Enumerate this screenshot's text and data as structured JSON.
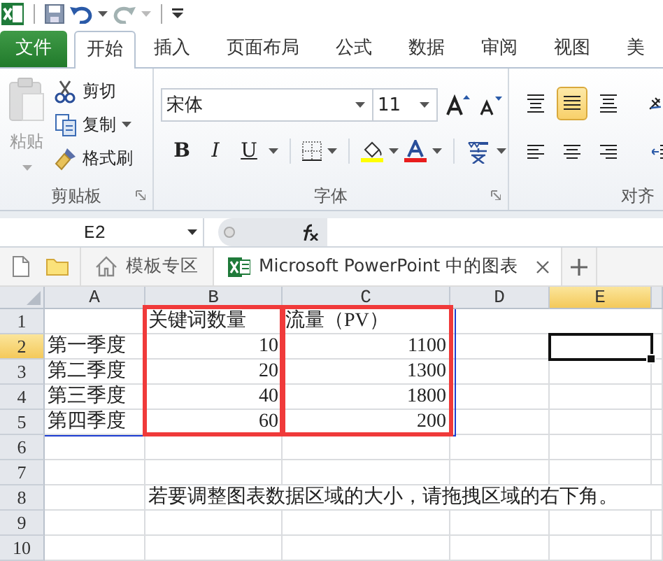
{
  "quick_access": [
    {
      "kind": "logo",
      "disabled": false
    },
    {
      "kind": "save",
      "disabled": false
    },
    {
      "kind": "undo",
      "disabled": false
    },
    {
      "kind": "redo",
      "disabled": true
    },
    {
      "kind": "customize",
      "disabled": false
    }
  ],
  "ribbon_tabs": [
    {
      "label": "文件",
      "kind": "file",
      "selected": false
    },
    {
      "label": "开始",
      "kind": "tab",
      "selected": true
    },
    {
      "label": "插入",
      "kind": "tab",
      "selected": false
    },
    {
      "label": "页面布局",
      "kind": "tab",
      "selected": false
    },
    {
      "label": "公式",
      "kind": "tab",
      "selected": false
    },
    {
      "label": "数据",
      "kind": "tab",
      "selected": false
    },
    {
      "label": "审阅",
      "kind": "tab",
      "selected": false
    },
    {
      "label": "视图",
      "kind": "tab",
      "selected": false
    },
    {
      "label": "美",
      "kind": "tab",
      "selected": false
    }
  ],
  "clipboard": {
    "paste": {
      "label": "粘贴",
      "disabled": true
    },
    "commands": [
      {
        "label": "剪切",
        "kind": "cut"
      },
      {
        "label": "复制",
        "kind": "copy"
      },
      {
        "label": "格式刷",
        "kind": "painter"
      }
    ],
    "group_label": "剪贴板"
  },
  "font": {
    "font_name": "宋体",
    "font_size": "11",
    "style_buttons": [
      {
        "label": "B",
        "kind": "bold"
      },
      {
        "label": "I",
        "kind": "italic"
      },
      {
        "label": "U",
        "kind": "underline"
      }
    ],
    "group_label": "字体"
  },
  "alignment": {
    "buttons": [
      {
        "kind": "top",
        "selected": false
      },
      {
        "kind": "middle",
        "selected": true
      },
      {
        "kind": "bottom",
        "selected": false
      },
      {
        "kind": "orientation",
        "selected": false
      },
      {
        "kind": "left",
        "selected": false
      },
      {
        "kind": "center",
        "selected": false
      },
      {
        "kind": "right",
        "selected": false
      },
      {
        "kind": "indent",
        "selected": false
      }
    ],
    "group_label": "对齐"
  },
  "formula_bar": {
    "name_box": "E2"
  },
  "document_tabs": [
    {
      "label": "模板专区",
      "kind": "home",
      "selected": false
    },
    {
      "label": "Microsoft PowerPoint 中的图表",
      "kind": "workbook",
      "selected": true
    }
  ],
  "sheet": {
    "columns": [
      {
        "label": "A",
        "selected": false,
        "chart_range": true,
        "framed": false
      },
      {
        "label": "B",
        "selected": false,
        "chart_range": true,
        "framed": true
      },
      {
        "label": "C",
        "selected": false,
        "chart_range": true,
        "framed": true
      },
      {
        "label": "D",
        "selected": false,
        "chart_range": false,
        "framed": false
      },
      {
        "label": "E",
        "selected": true,
        "chart_range": false,
        "framed": false
      }
    ],
    "rows": [
      {
        "label": "1",
        "selected": false,
        "chart_range": true,
        "cells": {
          "B": {
            "text": "关键词数量",
            "kind": "text",
            "selected": false
          },
          "C": {
            "text": "流量（PV）",
            "kind": "text",
            "selected": false
          }
        }
      },
      {
        "label": "2",
        "selected": true,
        "chart_range": true,
        "cells": {
          "A": {
            "text": "第一季度",
            "kind": "text",
            "selected": false
          },
          "B": {
            "text": "10",
            "kind": "number",
            "selected": false
          },
          "C": {
            "text": "1100",
            "kind": "number",
            "selected": false
          },
          "E": {
            "selected": true
          }
        }
      },
      {
        "label": "3",
        "selected": false,
        "chart_range": true,
        "cells": {
          "A": {
            "text": "第二季度",
            "kind": "text",
            "selected": false
          },
          "B": {
            "text": "20",
            "kind": "number",
            "selected": false
          },
          "C": {
            "text": "1300",
            "kind": "number",
            "selected": false
          }
        }
      },
      {
        "label": "4",
        "selected": false,
        "chart_range": true,
        "cells": {
          "A": {
            "text": "第三季度",
            "kind": "text",
            "selected": false
          },
          "B": {
            "text": "40",
            "kind": "number",
            "selected": false
          },
          "C": {
            "text": "1800",
            "kind": "number",
            "selected": false
          }
        }
      },
      {
        "label": "5",
        "selected": false,
        "chart_range": true,
        "cells": {
          "A": {
            "text": "第四季度",
            "kind": "text",
            "selected": false
          },
          "B": {
            "text": "60",
            "kind": "number",
            "selected": false
          },
          "C": {
            "text": "200",
            "kind": "number",
            "selected": false
          }
        }
      },
      {
        "label": "6",
        "selected": false,
        "chart_range": false,
        "cells": {}
      },
      {
        "label": "7",
        "selected": false,
        "chart_range": false,
        "cells": {}
      },
      {
        "label": "8",
        "selected": false,
        "chart_range": false,
        "cells": {
          "B": {
            "text": "若要调整图表数据区域的大小，请拖拽区域的右下角。",
            "kind": "text",
            "selected": false
          }
        }
      },
      {
        "label": "9",
        "selected": false,
        "chart_range": false,
        "cells": {}
      },
      {
        "label": "10",
        "selected": false,
        "chart_range": false,
        "cells": {}
      }
    ]
  }
}
